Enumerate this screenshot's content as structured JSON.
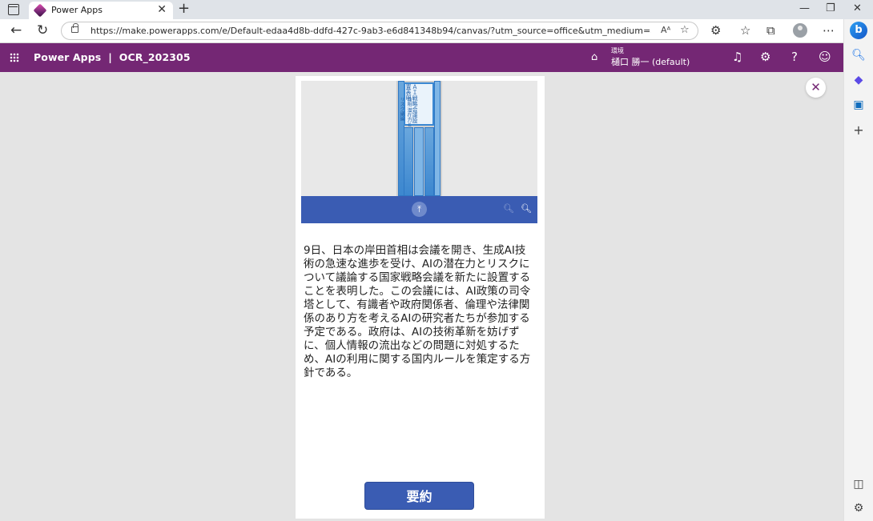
{
  "browser": {
    "tab_title": "Power Apps",
    "url": "https://make.powerapps.com/e/Default-edaa4d8b-ddfd-427c-9ab3-e6d841348b94/canvas/?utm_source=office&utm_medium=app_launcher&utm_...",
    "read_aloud_icon": "Aᴬ"
  },
  "header": {
    "app_title": "Power Apps  |  OCR_202305",
    "env_label": "環境",
    "env_name": "樋口 勝一 (default)"
  },
  "document_image": {
    "headline": "ＡＩ戦略会議設置表明",
    "subhead": "首相 潜在力とリスク議論"
  },
  "ocr_text": "9日、日本の岸田首相は会議を開き、生成AI技術の急速な進歩を受け、AIの潜在力とリスクについて議論する国家戦略会議を新たに設置することを表明した。この会議には、AI政策の司令塔として、有識者や政府関係者、倫理や法律関係のあり方を考えるAIの研究者たちが参加する予定である。政府は、AIの技術革新を妨げずに、個人情報の流出などの問題に対処するため、AIの利用に関する国内ルールを策定する方針である。",
  "summary_button": "要約",
  "colors": {
    "header_bg": "#742774",
    "button_bg": "#3a5cb3",
    "canvas_bg": "#e4e4e4"
  }
}
